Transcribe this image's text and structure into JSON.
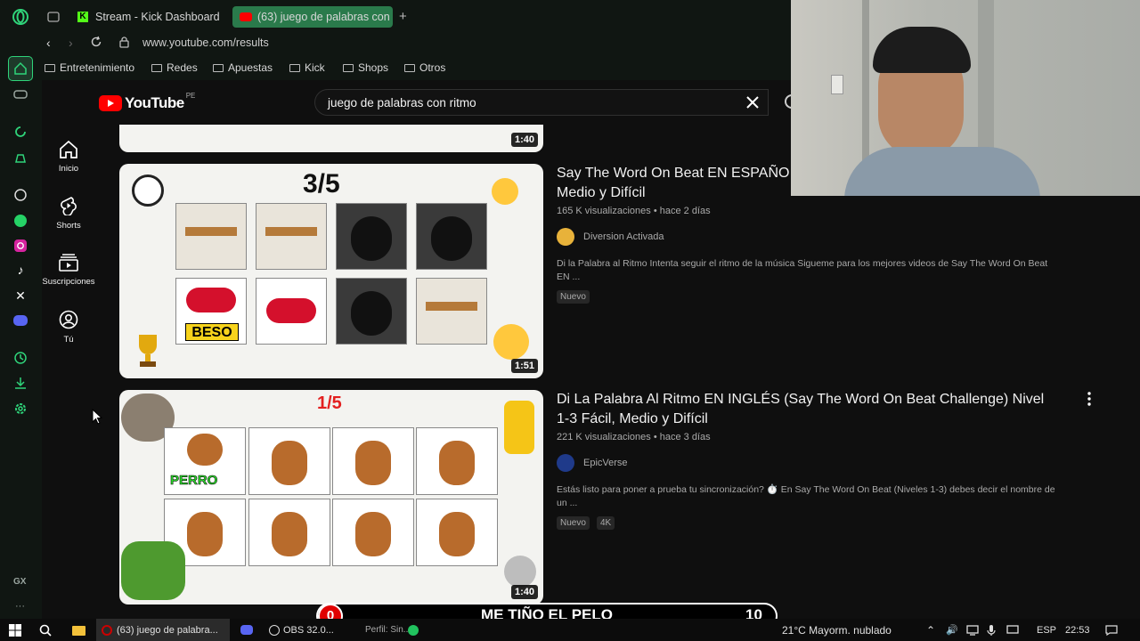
{
  "browser": {
    "tabs": [
      {
        "label": "Stream - Kick Dashboard",
        "icon": "kick-icon"
      },
      {
        "label": "(63) juego de palabras con",
        "icon": "youtube-icon"
      }
    ],
    "new_tab_symbol": "+",
    "url": "www.youtube.com/results",
    "bookmarks": [
      "Entretenimiento",
      "Redes",
      "Apuestas",
      "Kick",
      "Shops",
      "Otros"
    ],
    "sidebar_footer": "GX",
    "accent": "#2fd47a"
  },
  "youtube": {
    "logo_text": "YouTube",
    "region": "PE",
    "search_value": "juego de palabras con ritmo",
    "nav": [
      {
        "label": "Inicio",
        "icon": "home-icon"
      },
      {
        "label": "Shorts",
        "icon": "shorts-icon"
      },
      {
        "label": "Suscripciones",
        "icon": "subscriptions-icon"
      },
      {
        "label": "Tú",
        "icon": "you-icon"
      }
    ],
    "top_partial_duration": "1:40",
    "videos": [
      {
        "title": "Say The Word On Beat EN ESPAÑOL Medio y Difícil",
        "title_line1": "Say The Word On Beat EN ESPAÑO",
        "title_line2": "Medio y Difícil",
        "meta": "165 K visualizaciones • hace 2 días",
        "channel": "Diversion Activada",
        "description_line1": "Di la Palabra al Ritmo Intenta seguir el ritmo de la música Sigueme para los mejores videos de Say The Word On Beat",
        "description_line2": "EN ...",
        "badges": [
          "Nuevo"
        ],
        "duration": "1:51",
        "thumb_counter": "3/5",
        "thumb_word": "BESO"
      },
      {
        "title_line1": "Di La Palabra Al Ritmo EN INGLÉS (Say The Word On Beat Challenge) Nivel",
        "title_line2": "1-3 Fácil, Medio y Difícil",
        "meta": "221 K visualizaciones • hace 3 días",
        "channel": "EpicVerse",
        "description_line1": "Estás listo para poner a prueba tu sincronización? ⏱️ En Say The Word On Beat (Niveles 1-3) debes decir el nombre de",
        "description_line2": "un ...",
        "badges": [
          "Nuevo",
          "4K"
        ],
        "duration": "1:40",
        "thumb_counter": "1/5",
        "thumb_word": "PERRO"
      }
    ]
  },
  "overlay": {
    "left_score": "0",
    "text": "ME TIÑO EL PELO",
    "right_score": "10"
  },
  "taskbar": {
    "items": [
      {
        "label": "(63) juego de palabra...",
        "icon": "opera-icon"
      },
      {
        "label": "OBS 32.0...",
        "icon": "obs-icon"
      },
      {
        "label": "Perfil: Sin...",
        "icon": "obs-profile-icon"
      }
    ],
    "weather": "21°C  Mayorm. nublado",
    "language": "ESP",
    "time": "22:53"
  }
}
